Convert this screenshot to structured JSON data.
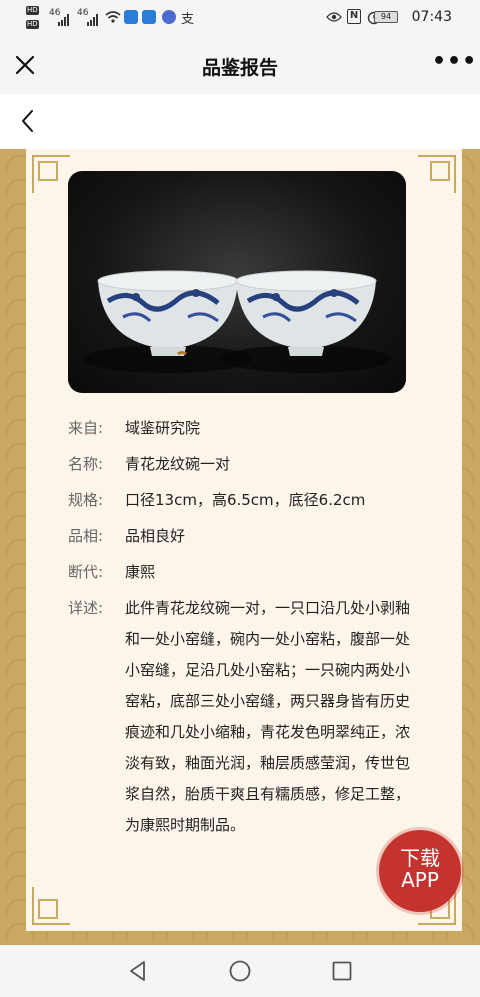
{
  "status_bar": {
    "time": "07:43",
    "battery": "94",
    "signal_1": "46",
    "signal_2": "46",
    "hd": "HD"
  },
  "nav": {
    "title": "品鉴报告",
    "more": "•••"
  },
  "report": {
    "rows": [
      {
        "label": "来自:",
        "value": "域鉴研究院"
      },
      {
        "label": "名称:",
        "value": "青花龙纹碗一对"
      },
      {
        "label": "规格:",
        "value": "口径13cm，高6.5cm，底径6.2cm"
      },
      {
        "label": "品相:",
        "value": "品相良好"
      },
      {
        "label": "断代:",
        "value": "康熙"
      }
    ],
    "detail_label": "详述:",
    "detail_value": "此件青花龙纹碗一对，一只口沿几处小剥釉和一处小窑缝，碗内一处小窑粘，腹部一处小窑缝，足沿几处小窑粘；一只碗内两处小窑粘，底部三处小窑缝，两只器身皆有历史痕迹和几处小缩釉，青花发色明翠纯正，浓淡有致，釉面光润，釉层质感莹润，传世包浆自然，胎质干爽且有糯质感，修足工整，为康熙时期制品。"
  },
  "download": {
    "line1": "下载",
    "line2": "APP"
  },
  "colors": {
    "frame_gold": "#c9a961",
    "card_bg": "#fdf5ea",
    "download_red": "#c4332e"
  }
}
